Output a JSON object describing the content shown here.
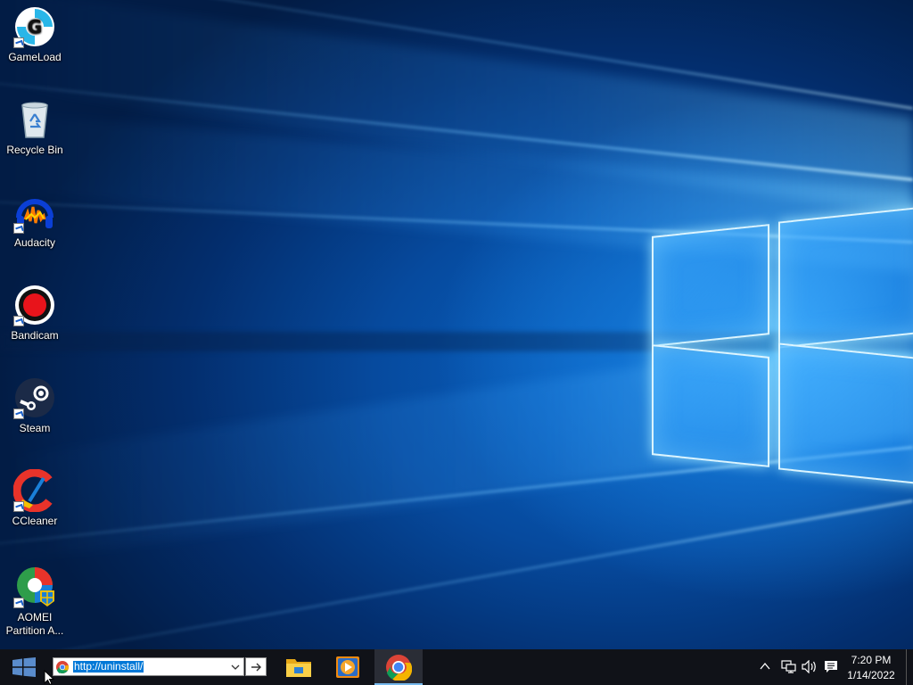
{
  "desktop": {
    "icons": [
      {
        "label": "GameLoad"
      },
      {
        "label": "Recycle Bin"
      },
      {
        "label": "Audacity"
      },
      {
        "label": "Bandicam"
      },
      {
        "label": "Steam"
      },
      {
        "label": "CCleaner"
      },
      {
        "label": "AOMEI Partition A..."
      }
    ]
  },
  "taskbar": {
    "address": {
      "value": "http://uninstall/"
    },
    "pinned": [
      {
        "icon": "file-explorer-icon"
      },
      {
        "icon": "media-player-icon"
      },
      {
        "icon": "chrome-icon"
      }
    ],
    "clock": {
      "time": "7:20 PM",
      "date": "1/14/2022"
    }
  },
  "colors": {
    "taskbar_bg": "#101218",
    "accent": "#0078d7",
    "active_indicator": "#76b9ed"
  }
}
